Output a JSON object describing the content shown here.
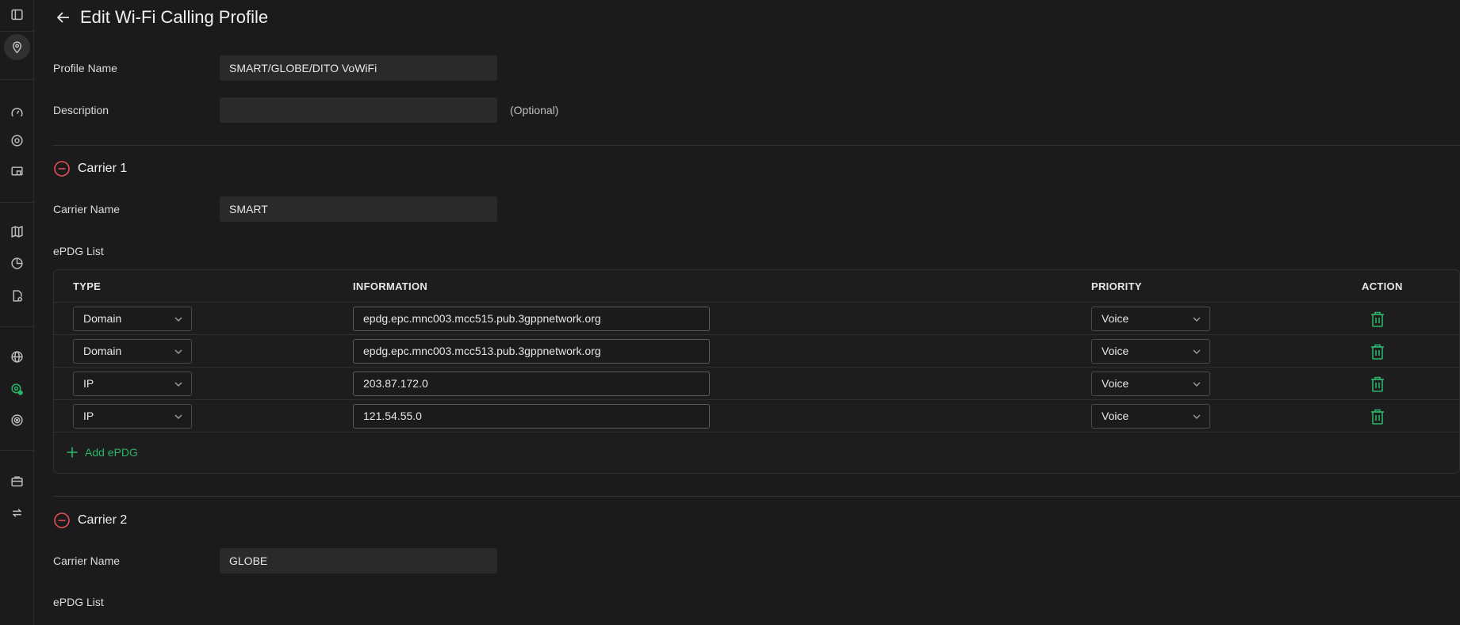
{
  "page": {
    "title": "Edit Wi-Fi Calling Profile"
  },
  "sidebar": {
    "icons": [
      "panel-toggle-icon",
      "location-pin-icon",
      "speedometer-icon",
      "target-icon",
      "devices-icon",
      "map-icon",
      "pie-chart-icon",
      "report-icon",
      "globe-icon",
      "wifi-calling-icon",
      "signal-icon",
      "briefcase-icon",
      "sync-icon"
    ]
  },
  "form": {
    "profile_name_label": "Profile Name",
    "profile_name_value": "SMART/GLOBE/DITO VoWiFi",
    "description_label": "Description",
    "description_value": "",
    "description_hint": "(Optional)"
  },
  "carriers": [
    {
      "title": "Carrier 1",
      "name_label": "Carrier Name",
      "name_value": "SMART",
      "epdg_label": "ePDG List",
      "columns": [
        "TYPE",
        "INFORMATION",
        "PRIORITY",
        "ACTION"
      ],
      "rows": [
        {
          "type": "Domain",
          "information": "epdg.epc.mnc003.mcc515.pub.3gppnetwork.org",
          "priority": "Voice"
        },
        {
          "type": "Domain",
          "information": "epdg.epc.mnc003.mcc513.pub.3gppnetwork.org",
          "priority": "Voice"
        },
        {
          "type": "IP",
          "information": "203.87.172.0",
          "priority": "Voice"
        },
        {
          "type": "IP",
          "information": "121.54.55.0",
          "priority": "Voice"
        }
      ],
      "add_label": "Add ePDG"
    },
    {
      "title": "Carrier 2",
      "name_label": "Carrier Name",
      "name_value": "GLOBE",
      "epdg_label": "ePDG List"
    }
  ],
  "colors": {
    "accent_green": "#2db36a",
    "remove_red": "#e0505a",
    "background": "#1b1b1b"
  }
}
